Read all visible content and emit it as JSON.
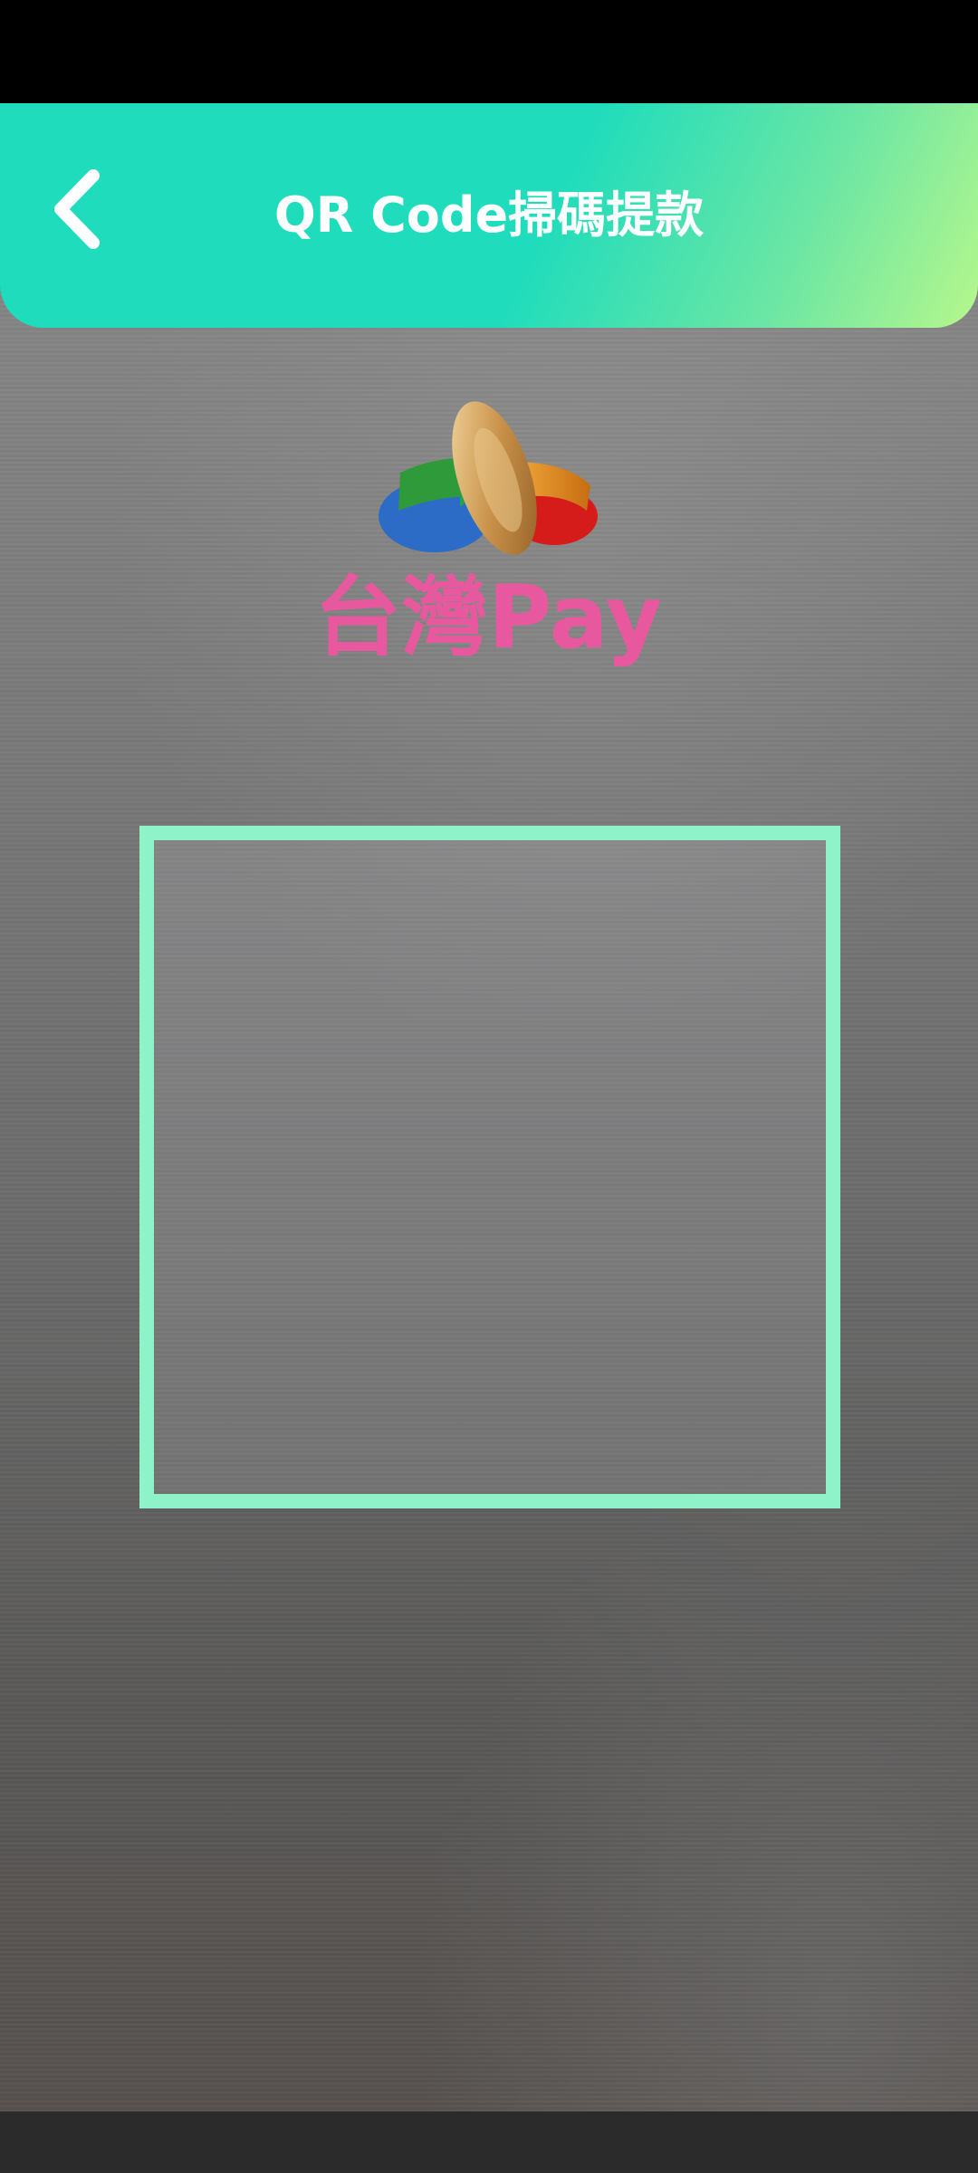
{
  "header": {
    "title": "QR Code掃碼提款",
    "back_icon": "chevron-left-icon"
  },
  "logo": {
    "text": "台灣Pay",
    "icon": "taiwan-pay-logo-icon",
    "text_color": "#e8589e"
  },
  "colors": {
    "header_start": "#1edcbc",
    "header_end": "#b6f78c",
    "scan_frame": "#8ef3c8"
  }
}
